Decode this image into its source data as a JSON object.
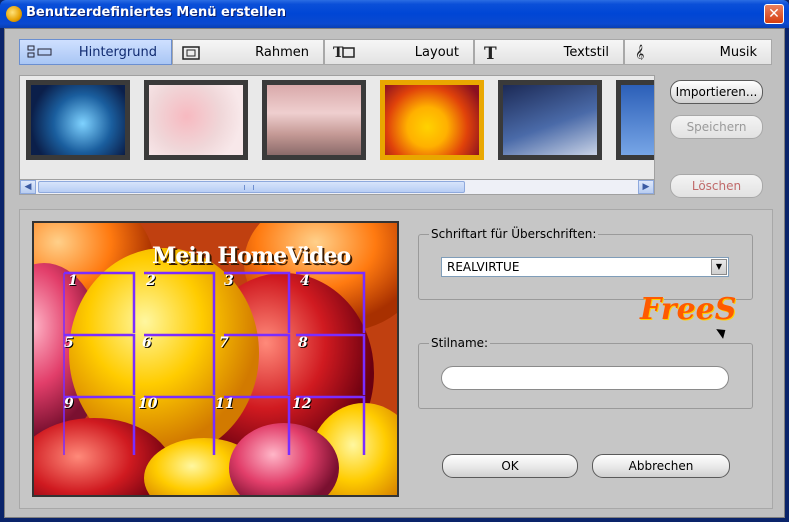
{
  "window": {
    "title": "Benutzerdefiniertes Menü erstellen",
    "close_glyph": "✕"
  },
  "tabs": [
    {
      "label": "Hintergrund",
      "icon": "layout-grid-icon",
      "active": true
    },
    {
      "label": "Rahmen",
      "icon": "frame-icon",
      "active": false
    },
    {
      "label": "Layout",
      "icon": "text-frame-icon",
      "active": false
    },
    {
      "label": "Textstil",
      "icon": "text-style-icon",
      "active": false
    },
    {
      "label": "Musik",
      "icon": "music-note-icon",
      "active": false
    }
  ],
  "thumbnails": [
    {
      "name": "baby-shoes",
      "selected": false
    },
    {
      "name": "pink-baby",
      "selected": false
    },
    {
      "name": "toys-pink",
      "selected": false
    },
    {
      "name": "balloons",
      "selected": true
    },
    {
      "name": "graduation",
      "selected": false
    },
    {
      "name": "blue-sky",
      "selected": false
    }
  ],
  "side_buttons": {
    "import": "Importieren...",
    "save": "Speichern",
    "delete": "Löschen"
  },
  "preview": {
    "title": "Mein HomeVideo",
    "cells": [
      "1",
      "2",
      "3",
      "4",
      "5",
      "6",
      "7",
      "8",
      "9",
      "10",
      "11",
      "12"
    ]
  },
  "font_group": {
    "label": "Schriftart für Überschriften:",
    "value": "REALVIRTUE"
  },
  "style_group": {
    "label": "Stilname:",
    "value": ""
  },
  "footer": {
    "ok": "OK",
    "cancel": "Abbrechen"
  },
  "watermark": "FreeS",
  "colors": {
    "accent": "#e9a700",
    "title_bar": "#0046d5",
    "grid": "#7b2cff"
  }
}
